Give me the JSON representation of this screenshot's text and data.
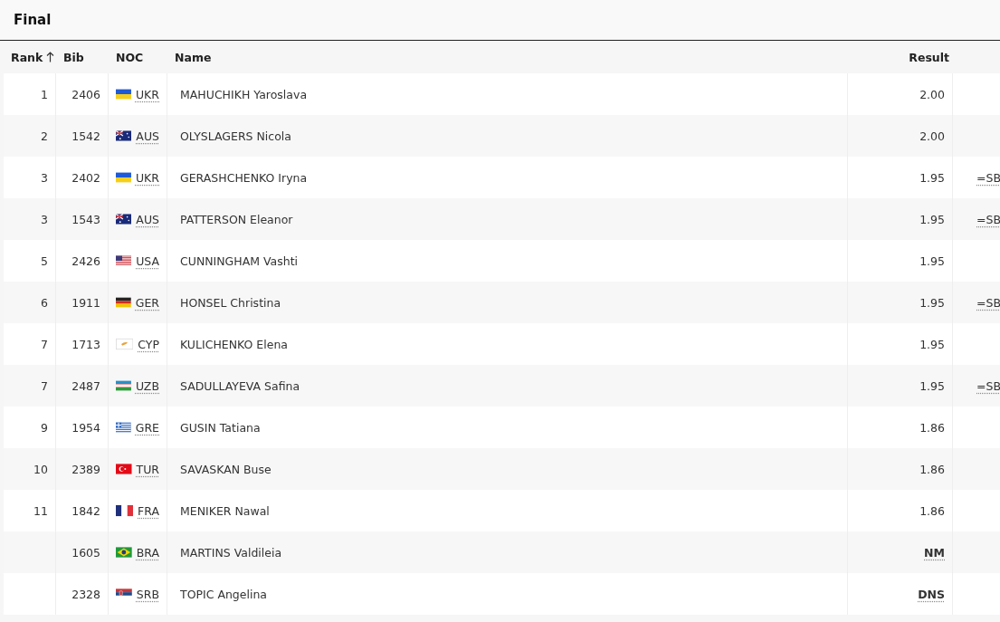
{
  "title": "Final",
  "columns": [
    {
      "label": "Rank",
      "sorted": true
    },
    {
      "label": "Bib",
      "sorted": false
    },
    {
      "label": "NOC",
      "sorted": false
    },
    {
      "label": "Name",
      "sorted": false
    },
    {
      "label": "Result",
      "sorted": false
    }
  ],
  "rows": [
    {
      "rank": "1",
      "bib": "2406",
      "noc": {
        "code": "UKR",
        "kind": "ukraine"
      },
      "name": "MAHUCHIKH Yaroslava",
      "result": "2.00",
      "kind": "mark"
    },
    {
      "rank": "2",
      "bib": "1542",
      "noc": {
        "code": "AUS",
        "kind": "australia"
      },
      "name": "OLYSLAGERS Nicola",
      "result": "2.00",
      "kind": "mark"
    },
    {
      "rank": "3",
      "bib": "2402",
      "noc": {
        "code": "UKR",
        "kind": "ukraine"
      },
      "name": "GERASHCHENKO Iryna",
      "result": "1.95",
      "kind": "mark",
      "note": "=SB"
    },
    {
      "rank": "3",
      "bib": "1543",
      "noc": {
        "code": "AUS",
        "kind": "australia"
      },
      "name": "PATTERSON Eleanor",
      "result": "1.95",
      "kind": "mark",
      "note": "=SB"
    },
    {
      "rank": "5",
      "bib": "2426",
      "noc": {
        "code": "USA",
        "kind": "usa"
      },
      "name": "CUNNINGHAM Vashti",
      "result": "1.95",
      "kind": "mark"
    },
    {
      "rank": "6",
      "bib": "1911",
      "noc": {
        "code": "GER",
        "kind": "germany"
      },
      "name": "HONSEL Christina",
      "result": "1.95",
      "kind": "mark",
      "note": "=SB"
    },
    {
      "rank": "7",
      "bib": "1713",
      "noc": {
        "code": "CYP",
        "kind": "cyprus"
      },
      "name": "KULICHENKO Elena",
      "result": "1.95",
      "kind": "mark"
    },
    {
      "rank": "7",
      "bib": "2487",
      "noc": {
        "code": "UZB",
        "kind": "uzbekistan"
      },
      "name": "SADULLAYEVA Safina",
      "result": "1.95",
      "kind": "mark",
      "note": "=SB"
    },
    {
      "rank": "9",
      "bib": "1954",
      "noc": {
        "code": "GRE",
        "kind": "greece"
      },
      "name": "GUSIN Tatiana",
      "result": "1.86",
      "kind": "mark"
    },
    {
      "rank": "10",
      "bib": "2389",
      "noc": {
        "code": "TUR",
        "kind": "turkey"
      },
      "name": "SAVASKAN Buse",
      "result": "1.86",
      "kind": "mark"
    },
    {
      "rank": "11",
      "bib": "1842",
      "noc": {
        "code": "FRA",
        "kind": "france"
      },
      "name": "MENIKER Nawal",
      "result": "1.86",
      "kind": "mark"
    },
    {
      "bib": "1605",
      "noc": {
        "code": "BRA",
        "kind": "brazil"
      },
      "name": "MARTINS Valdileia",
      "result": "NM",
      "kind": "code"
    },
    {
      "bib": "2328",
      "noc": {
        "code": "SRB",
        "kind": "serbia"
      },
      "name": "TOPIC Angelina",
      "result": "DNS",
      "kind": "code"
    }
  ]
}
